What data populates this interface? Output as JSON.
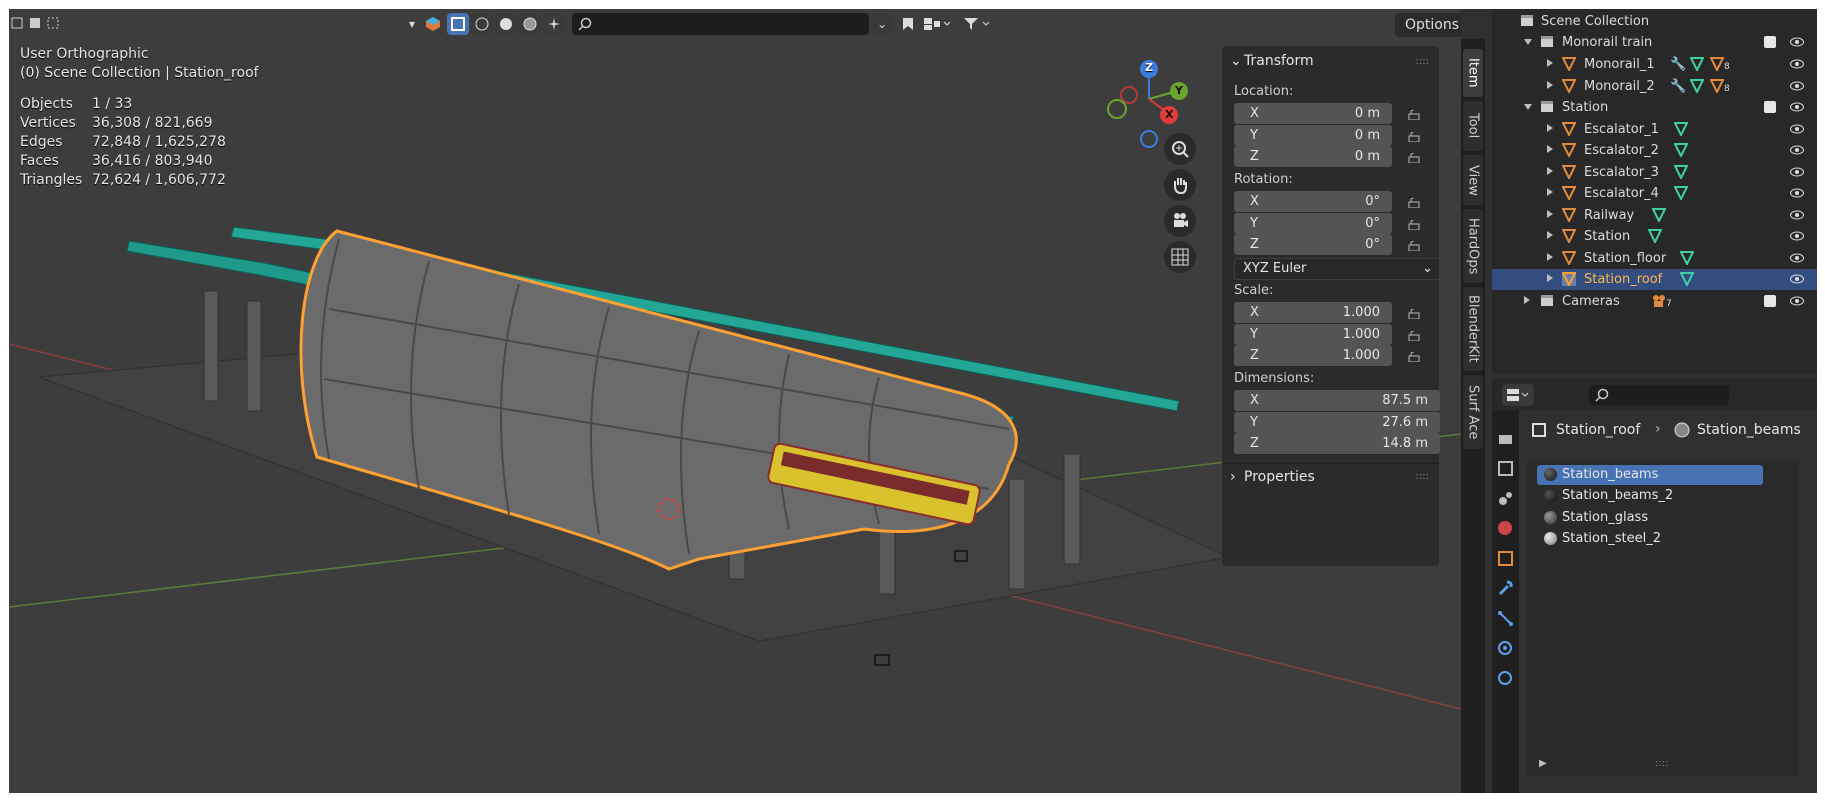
{
  "viewport": {
    "view_name": "User Orthographic",
    "context": "(0) Scene Collection | Station_roof",
    "stats": [
      {
        "label": "Objects",
        "value": "1 / 33"
      },
      {
        "label": "Vertices",
        "value": "36,308 / 821,669"
      },
      {
        "label": "Edges",
        "value": "72,848 / 1,625,278"
      },
      {
        "label": "Faces",
        "value": "36,416 / 803,940"
      },
      {
        "label": "Triangles",
        "value": "72,624 / 1,606,772"
      }
    ],
    "options_label": "Options",
    "gizmo": {
      "x": "X",
      "y": "Y",
      "z": "Z"
    }
  },
  "npanel": {
    "transform_title": "Transform",
    "location_label": "Location:",
    "location": [
      {
        "axis": "X",
        "value": "0 m"
      },
      {
        "axis": "Y",
        "value": "0 m"
      },
      {
        "axis": "Z",
        "value": "0 m"
      }
    ],
    "rotation_label": "Rotation:",
    "rotation": [
      {
        "axis": "X",
        "value": "0°"
      },
      {
        "axis": "Y",
        "value": "0°"
      },
      {
        "axis": "Z",
        "value": "0°"
      }
    ],
    "rotation_mode": "XYZ Euler",
    "scale_label": "Scale:",
    "scale": [
      {
        "axis": "X",
        "value": "1.000"
      },
      {
        "axis": "Y",
        "value": "1.000"
      },
      {
        "axis": "Z",
        "value": "1.000"
      }
    ],
    "dimensions_label": "Dimensions:",
    "dimensions": [
      {
        "axis": "X",
        "value": "87.5 m"
      },
      {
        "axis": "Y",
        "value": "27.6 m"
      },
      {
        "axis": "Z",
        "value": "14.8 m"
      }
    ],
    "properties_title": "Properties"
  },
  "side_tabs": [
    "Item",
    "Tool",
    "View",
    "HardOps",
    "BlenderKit",
    "Surf Ace"
  ],
  "outliner": {
    "root": "Scene Collection",
    "rows": [
      {
        "label": "Monorail train",
        "kind": "collection",
        "level": 1
      },
      {
        "label": "Monorail_1",
        "kind": "object",
        "level": 2,
        "badge": "8"
      },
      {
        "label": "Monorail_2",
        "kind": "object",
        "level": 2,
        "badge": "8"
      },
      {
        "label": "Station",
        "kind": "collection",
        "level": 1
      },
      {
        "label": "Escalator_1",
        "kind": "object",
        "level": 2
      },
      {
        "label": "Escalator_2",
        "kind": "object",
        "level": 2
      },
      {
        "label": "Escalator_3",
        "kind": "object",
        "level": 2
      },
      {
        "label": "Escalator_4",
        "kind": "object",
        "level": 2
      },
      {
        "label": "Railway",
        "kind": "object",
        "level": 2
      },
      {
        "label": "Station",
        "kind": "object",
        "level": 2
      },
      {
        "label": "Station_floor",
        "kind": "object",
        "level": 2
      },
      {
        "label": "Station_roof",
        "kind": "object",
        "level": 2,
        "selected": true
      },
      {
        "label": "Cameras",
        "kind": "collection",
        "level": 0,
        "badge": "7"
      }
    ]
  },
  "properties": {
    "breadcrumb_object": "Station_roof",
    "breadcrumb_material": "Station_beams",
    "materials": [
      {
        "name": "Station_beams",
        "selected": true
      },
      {
        "name": "Station_beams_2"
      },
      {
        "name": "Station_glass"
      },
      {
        "name": "Station_steel_2"
      }
    ]
  },
  "colors": {
    "accent": "#4772b3",
    "selection": "#ffa033",
    "mesh_icon": "#e08a3a",
    "data_icon": "#3fcfa0"
  }
}
